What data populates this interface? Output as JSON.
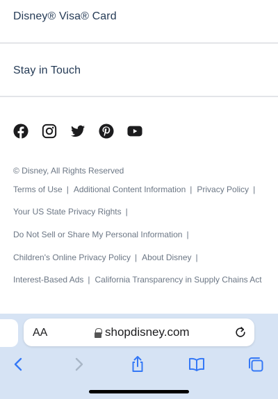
{
  "footer": {
    "links": {
      "disney_visa": "Disney® Visa® Card",
      "stay_in_touch": "Stay in Touch"
    },
    "social_icons": [
      "facebook-icon",
      "instagram-icon",
      "twitter-icon",
      "pinterest-icon",
      "youtube-icon"
    ],
    "copyright": "© Disney, All Rights Reserved",
    "legal": {
      "terms_of_use": "Terms of Use",
      "additional_content": "Additional Content Information",
      "privacy_policy": "Privacy Policy",
      "us_state_privacy": "Your US State Privacy Rights",
      "do_not_sell": "Do Not Sell or Share My Personal Information",
      "childrens_privacy": "Children's Online Privacy Policy",
      "about_disney": "About Disney",
      "interest_based_ads": "Interest-Based Ads",
      "california_transparency": "California Transparency in Supply Chains Act"
    },
    "separator": "|"
  },
  "browser": {
    "text_size_button": "AA",
    "url": "shopdisney.com",
    "toolbar_icons": [
      "back-icon",
      "forward-icon",
      "share-icon",
      "bookmarks-icon",
      "tabs-icon"
    ]
  },
  "colors": {
    "text_primary": "#253b56",
    "text_secondary": "#6b7684",
    "divider": "#e3e5e8",
    "toolbar_bg": "#d6e3f4",
    "toolbar_accent": "#3478f6"
  }
}
